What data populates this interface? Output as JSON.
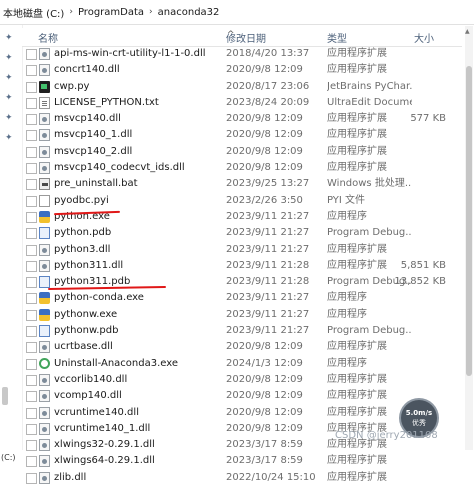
{
  "address": {
    "crumbs": [
      "本地磁盘 (C:)",
      "ProgramData",
      "anaconda32"
    ],
    "separator": "›"
  },
  "columns": {
    "name": "名称",
    "date": "修改日期",
    "type": "类型",
    "size": "大小"
  },
  "nav": {
    "bottom_label": "(C:)"
  },
  "files": [
    {
      "name": "api-ms-win-crt-utility-l1-1-0.dll",
      "date": "2018/4/20 13:37",
      "type": "应用程序扩展",
      "size": "",
      "icon": "dll"
    },
    {
      "name": "concrt140.dll",
      "date": "2020/9/8 12:09",
      "type": "应用程序扩展",
      "size": "",
      "icon": "dll"
    },
    {
      "name": "cwp.py",
      "date": "2020/8/17 23:06",
      "type": "JetBrains PyChar...",
      "size": "",
      "icon": "py"
    },
    {
      "name": "LICENSE_PYTHON.txt",
      "date": "2023/8/24 20:09",
      "type": "UltraEdit Document",
      "size": "",
      "icon": "text"
    },
    {
      "name": "msvcp140.dll",
      "date": "2020/9/8 12:09",
      "type": "应用程序扩展",
      "size": "577 KB",
      "icon": "dll"
    },
    {
      "name": "msvcp140_1.dll",
      "date": "2020/9/8 12:09",
      "type": "应用程序扩展",
      "size": "",
      "icon": "dll"
    },
    {
      "name": "msvcp140_2.dll",
      "date": "2020/9/8 12:09",
      "type": "应用程序扩展",
      "size": "",
      "icon": "dll"
    },
    {
      "name": "msvcp140_codecvt_ids.dll",
      "date": "2020/9/8 12:09",
      "type": "应用程序扩展",
      "size": "",
      "icon": "dll"
    },
    {
      "name": "pre_uninstall.bat",
      "date": "2023/9/25 13:27",
      "type": "Windows 批处理...",
      "size": "",
      "icon": "bat"
    },
    {
      "name": "pyodbc.pyi",
      "date": "2023/2/26 3:50",
      "type": "PYI 文件",
      "size": "",
      "icon": "file"
    },
    {
      "name": "python.exe",
      "date": "2023/9/11 21:27",
      "type": "应用程序",
      "size": "",
      "icon": "exe"
    },
    {
      "name": "python.pdb",
      "date": "2023/9/11 21:27",
      "type": "Program Debug...",
      "size": "",
      "icon": "pdb"
    },
    {
      "name": "python3.dll",
      "date": "2023/9/11 21:27",
      "type": "应用程序扩展",
      "size": "",
      "icon": "dll"
    },
    {
      "name": "python311.dll",
      "date": "2023/9/11 21:28",
      "type": "应用程序扩展",
      "size": "5,851 KB",
      "icon": "dll"
    },
    {
      "name": "python311.pdb",
      "date": "2023/9/11 21:28",
      "type": "Program Debug...",
      "size": "13,852 KB",
      "icon": "pdb"
    },
    {
      "name": "python-conda.exe",
      "date": "2023/9/11 21:27",
      "type": "应用程序",
      "size": "",
      "icon": "exe"
    },
    {
      "name": "pythonw.exe",
      "date": "2023/9/11 21:27",
      "type": "应用程序",
      "size": "",
      "icon": "exe"
    },
    {
      "name": "pythonw.pdb",
      "date": "2023/9/11 21:27",
      "type": "Program Debug...",
      "size": "",
      "icon": "pdb"
    },
    {
      "name": "ucrtbase.dll",
      "date": "2020/9/8 12:09",
      "type": "应用程序扩展",
      "size": "",
      "icon": "dll"
    },
    {
      "name": "Uninstall-Anaconda3.exe",
      "date": "2024/1/3 12:09",
      "type": "应用程序",
      "size": "",
      "icon": "uninst"
    },
    {
      "name": "vccorlib140.dll",
      "date": "2020/9/8 12:09",
      "type": "应用程序扩展",
      "size": "",
      "icon": "dll"
    },
    {
      "name": "vcomp140.dll",
      "date": "2020/9/8 12:09",
      "type": "应用程序扩展",
      "size": "",
      "icon": "dll"
    },
    {
      "name": "vcruntime140.dll",
      "date": "2020/9/8 12:09",
      "type": "应用程序扩展",
      "size": "",
      "icon": "dll"
    },
    {
      "name": "vcruntime140_1.dll",
      "date": "2020/9/8 12:09",
      "type": "应用程序扩展",
      "size": "",
      "icon": "dll"
    },
    {
      "name": "xlwings32-0.29.1.dll",
      "date": "2023/3/17 8:59",
      "type": "应用程序扩展",
      "size": "",
      "icon": "dll"
    },
    {
      "name": "xlwings64-0.29.1.dll",
      "date": "2023/3/17 8:59",
      "type": "应用程序扩展",
      "size": "",
      "icon": "dll"
    },
    {
      "name": "zlib.dll",
      "date": "2022/10/24 15:10",
      "type": "应用程序扩展",
      "size": "",
      "icon": "dll"
    }
  ],
  "badge": {
    "speed": "5.0m/s",
    "label": "优秀"
  },
  "watermark": "CSDN @jerry201108",
  "colors": {
    "annotation": "#e01818",
    "header_text": "#4c607a"
  }
}
